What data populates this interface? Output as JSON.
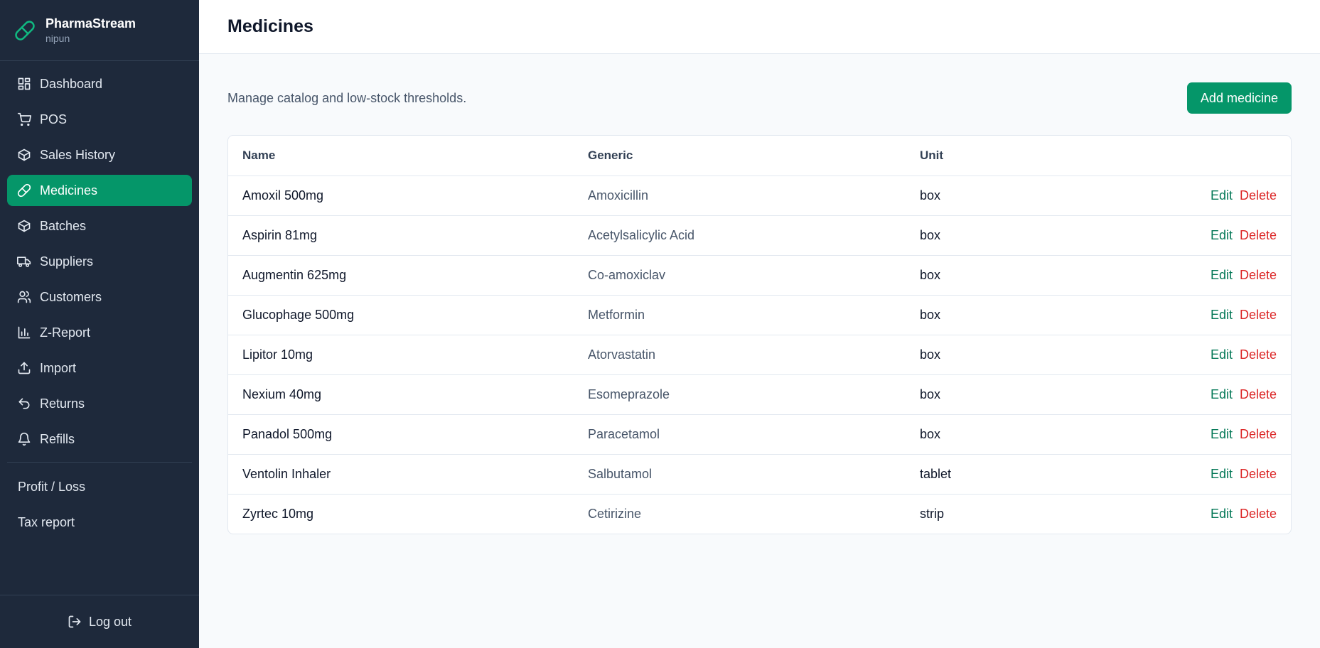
{
  "brand": {
    "name": "PharmaStream",
    "user": "nipun"
  },
  "nav": [
    {
      "id": "dashboard",
      "label": "Dashboard",
      "icon": "dashboard-icon",
      "active": false
    },
    {
      "id": "pos",
      "label": "POS",
      "icon": "cart-icon",
      "active": false
    },
    {
      "id": "sales-history",
      "label": "Sales History",
      "icon": "box-icon",
      "active": false
    },
    {
      "id": "medicines",
      "label": "Medicines",
      "icon": "pill-icon",
      "active": true
    },
    {
      "id": "batches",
      "label": "Batches",
      "icon": "box-icon",
      "active": false
    },
    {
      "id": "suppliers",
      "label": "Suppliers",
      "icon": "truck-icon",
      "active": false
    },
    {
      "id": "customers",
      "label": "Customers",
      "icon": "users-icon",
      "active": false
    },
    {
      "id": "z-report",
      "label": "Z-Report",
      "icon": "bar-chart-icon",
      "active": false
    },
    {
      "id": "import",
      "label": "Import",
      "icon": "upload-icon",
      "active": false
    },
    {
      "id": "returns",
      "label": "Returns",
      "icon": "undo-icon",
      "active": false
    },
    {
      "id": "refills",
      "label": "Refills",
      "icon": "bell-icon",
      "active": false
    }
  ],
  "nav_extra": [
    {
      "id": "profit-loss",
      "label": "Profit / Loss"
    },
    {
      "id": "tax-report",
      "label": "Tax report"
    }
  ],
  "logout_label": "Log out",
  "page": {
    "title": "Medicines",
    "subtitle": "Manage catalog and low-stock thresholds.",
    "add_label": "Add medicine"
  },
  "table": {
    "headers": {
      "name": "Name",
      "generic": "Generic",
      "unit": "Unit"
    },
    "edit_label": "Edit",
    "delete_label": "Delete",
    "rows": [
      {
        "name": "Amoxil 500mg",
        "generic": "Amoxicillin",
        "unit": "box"
      },
      {
        "name": "Aspirin 81mg",
        "generic": "Acetylsalicylic Acid",
        "unit": "box"
      },
      {
        "name": "Augmentin 625mg",
        "generic": "Co-amoxiclav",
        "unit": "box"
      },
      {
        "name": "Glucophage 500mg",
        "generic": "Metformin",
        "unit": "box"
      },
      {
        "name": "Lipitor 10mg",
        "generic": "Atorvastatin",
        "unit": "box"
      },
      {
        "name": "Nexium 40mg",
        "generic": "Esomeprazole",
        "unit": "box"
      },
      {
        "name": "Panadol 500mg",
        "generic": "Paracetamol",
        "unit": "box"
      },
      {
        "name": "Ventolin Inhaler",
        "generic": "Salbutamol",
        "unit": "tablet"
      },
      {
        "name": "Zyrtec 10mg",
        "generic": "Cetirizine",
        "unit": "strip"
      }
    ]
  },
  "colors": {
    "accent": "#059669",
    "sidebar": "#1e293b",
    "edit": "#047857",
    "delete": "#dc2626"
  }
}
